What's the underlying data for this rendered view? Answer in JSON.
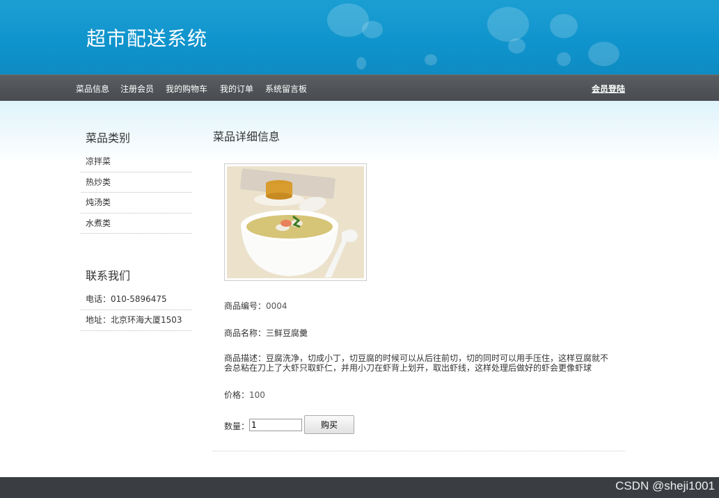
{
  "header": {
    "site_title": "超市配送系统"
  },
  "nav": {
    "items": [
      "菜品信息",
      "注册会员",
      "我的购物车",
      "我的订单",
      "系统留言板"
    ],
    "login": "会员登陆"
  },
  "sidebar": {
    "category_heading": "菜品类别",
    "categories": [
      "凉拌菜",
      "热炒类",
      "炖汤类",
      "水煮类"
    ],
    "contact_heading": "联系我们",
    "contact_phone": "电话：010-5896475",
    "contact_address": "地址：北京环海大厦1503"
  },
  "main": {
    "heading": "菜品详细信息",
    "product_id_label": "商品编号：",
    "product_id": "0004",
    "product_name_label": "商品名称：",
    "product_name": "三鲜豆腐羹",
    "description_label": "商品描述：",
    "description": "豆腐洗净，切成小丁，切豆腐的时候可以从后往前切，切的同时可以用手压住，这样豆腐就不会总粘在刀上了大虾只取虾仁，并用小刀在虾背上划开，取出虾线，这样处理后做好的虾会更像虾球",
    "price_label": "价格：",
    "price": "100",
    "quantity_label": "数量：",
    "quantity_value": "1",
    "buy_label": "购买"
  },
  "footer": {
    "watermark": "CSDN @sheji1001"
  }
}
